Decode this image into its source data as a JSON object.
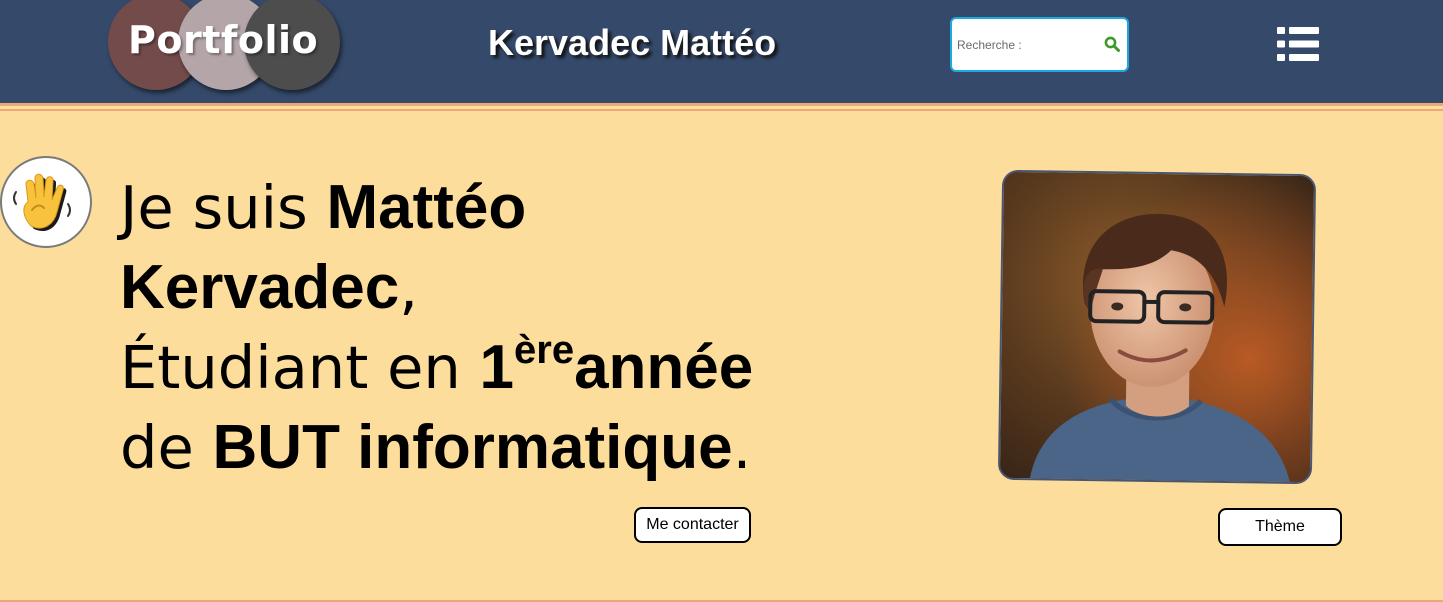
{
  "header": {
    "logo_text": "Portfolio",
    "title": "Kervadec Mattéo",
    "search": {
      "placeholder": "Recherche :",
      "icon": "search-icon"
    },
    "menu_icon": "list-menu-icon"
  },
  "hero": {
    "wave_icon": "waving-hand-icon",
    "intro": {
      "l1_prefix": "Je suis ",
      "name_first": "Mattéo",
      "name_last": "Kervadec",
      "comma": ",",
      "l3_prefix": "Étudiant en ",
      "ordinal": "1",
      "ordinal_sup": "ère",
      "year_word": "année",
      "l4_prefix": "de ",
      "degree": "BUT informatique",
      "period": "."
    },
    "portrait_alt": "portrait-photo",
    "contact_button": "Me contacter",
    "theme_button": "Thème"
  },
  "colors": {
    "header_bg": "#354a6b",
    "page_bg": "#fcdd9b",
    "accent_line": "#e8a878",
    "search_border": "#1ea8e0",
    "search_icon": "#3d9a28"
  }
}
